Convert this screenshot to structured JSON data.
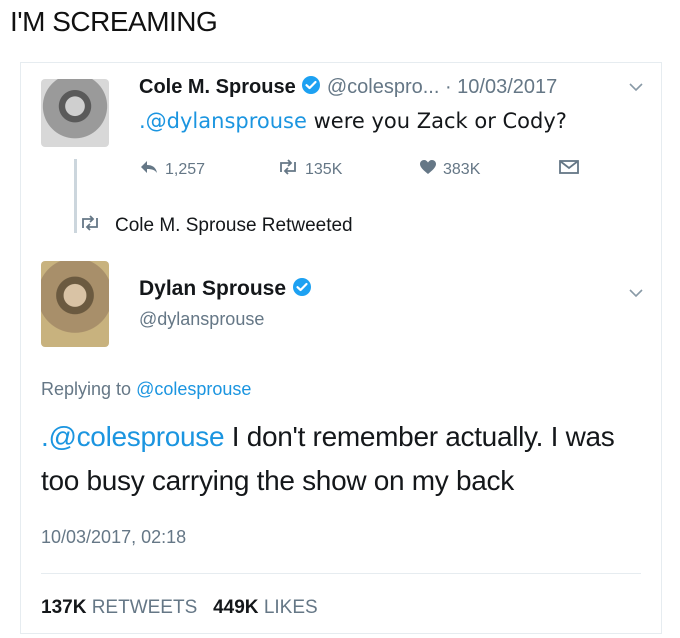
{
  "caption": "I'M SCREAMING",
  "tweet1": {
    "name": "Cole M. Sprouse",
    "handle": "@colespro...",
    "date": "· 10/03/2017",
    "mention": ".@dylansprouse",
    "text": " were you Zack or Cody?",
    "replies": "1,257",
    "retweets": "135K",
    "likes": "383K"
  },
  "retweet_label": "Cole M. Sprouse Retweeted",
  "tweet2": {
    "name": "Dylan Sprouse",
    "handle": "@dylansprouse",
    "replying_prefix": "Replying to ",
    "replying_handle": "@colesprouse",
    "mention": ".@colesprouse",
    "text": " I don't remember actually. I was too busy carrying the show on my back",
    "timestamp": "10/03/2017, 02:18",
    "retweet_count": "137K",
    "retweet_label": "RETWEETS",
    "like_count": "449K",
    "like_label": "LIKES"
  },
  "colors": {
    "link": "#1b95e0",
    "muted": "#657786",
    "verified": "#1da1f2"
  }
}
